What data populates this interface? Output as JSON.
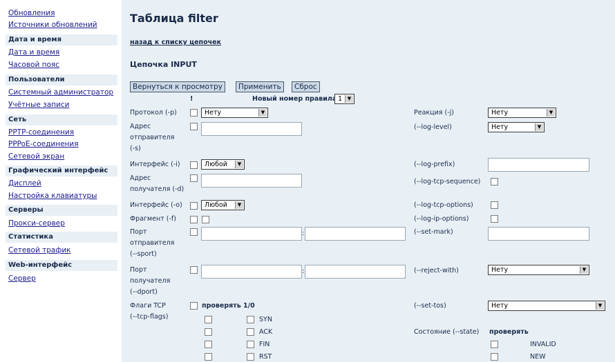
{
  "sidebar": {
    "items": [
      {
        "type": "link",
        "label": "Обновления"
      },
      {
        "type": "link",
        "label": "Источники обновлений"
      },
      {
        "type": "head",
        "label": "Дата и время"
      },
      {
        "type": "link",
        "label": "Дата и время"
      },
      {
        "type": "link",
        "label": "Часовой пояс"
      },
      {
        "type": "head",
        "label": "Пользователи"
      },
      {
        "type": "link",
        "label": "Системный администратор"
      },
      {
        "type": "link",
        "label": "Учётные записи"
      },
      {
        "type": "head",
        "label": "Сеть"
      },
      {
        "type": "link",
        "label": "PPTP-соединения"
      },
      {
        "type": "link",
        "label": "PPPoE-соединения"
      },
      {
        "type": "link",
        "label": "Сетевой экран"
      },
      {
        "type": "head",
        "label": "Графический интерфейс"
      },
      {
        "type": "link",
        "label": "Дисплей"
      },
      {
        "type": "link",
        "label": "Настройка клавиатуры"
      },
      {
        "type": "head",
        "label": "Серверы"
      },
      {
        "type": "link",
        "label": "Прокси-сервер"
      },
      {
        "type": "head",
        "label": "Статистика"
      },
      {
        "type": "link",
        "label": "Сетевой трафик"
      },
      {
        "type": "head",
        "label": "Web-интерфейс"
      },
      {
        "type": "link",
        "label": "Сервер"
      }
    ]
  },
  "main": {
    "title": "Таблица filter",
    "back_link": "назад к списку цепочек",
    "chain_title": "Цепочка INPUT",
    "buttons": {
      "back": "Вернуться к просмотру",
      "apply": "Применить",
      "reset": "Сброс"
    },
    "not_header": "!",
    "new_rule_label": "Новый номер правила",
    "new_rule_value": "1",
    "protocol": {
      "label": "Протокол (-p)",
      "value": "Нету"
    },
    "src_addr": {
      "label1": "Адрес",
      "label2": "отправителя",
      "label3": "(-s)"
    },
    "in_iface": {
      "label": "Интерфейс (-i)",
      "value": "Любой"
    },
    "dst_addr": {
      "label1": "Адрес",
      "label2": "получателя (-d)"
    },
    "out_iface": {
      "label": "Интерфейс (-o)",
      "value": "Любой"
    },
    "fragment": {
      "label": "Фрагмент (-f)"
    },
    "sport": {
      "label1": "Порт",
      "label2": "отправителя",
      "label3": "(--sport)",
      "sep": ":"
    },
    "dport": {
      "label1": "Порт",
      "label2": "получателя",
      "label3": "(--dport)",
      "sep": ":"
    },
    "tcp_flags": {
      "label1": "Флаги TCP",
      "label2": "(--tcp-flags)",
      "check_label": "проверять",
      "header_10": "1/0",
      "flags": [
        "SYN",
        "ACK",
        "FIN",
        "RST"
      ]
    },
    "right": {
      "jump": {
        "label": "Реакция (-j)",
        "value": "Нету"
      },
      "log_level": {
        "label": "(--log-level)",
        "value": "Нету"
      },
      "log_prefix": {
        "label": "(--log-prefix)"
      },
      "log_tcp_sequence": {
        "label": "(--log-tcp-sequence)"
      },
      "log_tcp_options": {
        "label": "(--log-tcp-options)"
      },
      "log_ip_options": {
        "label": "(--log-ip-options)"
      },
      "set_mark": {
        "label": "(--set-mark)"
      },
      "reject_with": {
        "label": "(--reject-with)",
        "value": "Нету"
      },
      "set_tos": {
        "label": "(--set-tos)",
        "value": "Нету"
      },
      "state": {
        "label": "Состояние (--state)",
        "check_label": "проверять",
        "options": [
          "INVALID",
          "NEW"
        ]
      }
    }
  }
}
